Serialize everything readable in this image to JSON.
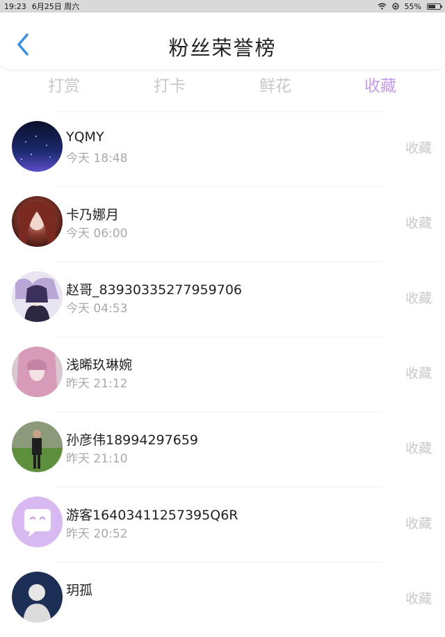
{
  "status_bar": {
    "time": "19:23",
    "date": "6月25日 周六",
    "battery": "55%",
    "battery_level": 0.55
  },
  "header": {
    "title": "粉丝荣誉榜",
    "back_icon": "chevron-left-icon",
    "accent_color": "#3a8fde"
  },
  "tabs": [
    {
      "label": "打赏",
      "active": false
    },
    {
      "label": "打卡",
      "active": false
    },
    {
      "label": "鲜花",
      "active": false
    },
    {
      "label": "收藏",
      "active": true
    }
  ],
  "colors": {
    "tab_active": "#c79be6",
    "tab_inactive": "#c8c8c8",
    "time_text": "#a9a9a9",
    "action_text": "#c9c9c9"
  },
  "list": [
    {
      "name": "YQMY",
      "time": "今天 18:48",
      "action": "收藏"
    },
    {
      "name": "卡乃娜月",
      "time": "今天 06:00",
      "action": "收藏"
    },
    {
      "name": "赵哥_83930335277959706",
      "time": "今天 04:53",
      "action": "收藏"
    },
    {
      "name": "浅晞玖琳婉",
      "time": "昨天 21:12",
      "action": "收藏"
    },
    {
      "name": "孙彦伟18994297659",
      "time": "昨天 21:10",
      "action": "收藏"
    },
    {
      "name": "游客16403411257395Q6R",
      "time": "昨天 20:52",
      "action": "收藏"
    },
    {
      "name": "玥孤",
      "time": "",
      "action": "收藏"
    }
  ]
}
